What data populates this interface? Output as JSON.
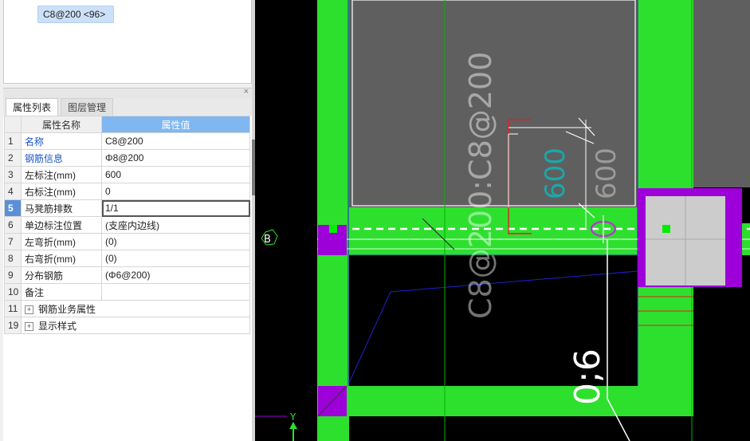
{
  "tree": {
    "selected_item": "C8@200 <96>"
  },
  "property_panel": {
    "tabs": [
      "属性列表",
      "图层管理"
    ],
    "headers": {
      "name": "属性名称",
      "value": "属性值"
    },
    "rows": [
      {
        "index": "1",
        "name": "名称",
        "value": "C8@200"
      },
      {
        "index": "2",
        "name": "钢筋信息",
        "value": "Φ8@200"
      },
      {
        "index": "3",
        "name": "左标注(mm)",
        "value": "600"
      },
      {
        "index": "4",
        "name": "右标注(mm)",
        "value": "0"
      },
      {
        "index": "5",
        "name": "马凳筋排数",
        "value": "1/1"
      },
      {
        "index": "6",
        "name": "单边标注位置",
        "value": "(支座内边线)"
      },
      {
        "index": "7",
        "name": "左弯折(mm)",
        "value": "(0)"
      },
      {
        "index": "8",
        "name": "右弯折(mm)",
        "value": "(0)"
      },
      {
        "index": "9",
        "name": "分布钢筋",
        "value": "(Φ6@200)"
      },
      {
        "index": "10",
        "name": "备注",
        "value": ""
      },
      {
        "index": "11",
        "name": "钢筋业务属性",
        "value": ""
      },
      {
        "index": "19",
        "name": "显示样式",
        "value": ""
      }
    ],
    "expander_symbol": "+",
    "close_symbol": "×"
  },
  "canvas": {
    "vertical_text_main": "C8@200:C8@200",
    "dimension_text_1": "600",
    "dimension_text_2": "600",
    "bottom_text": "0;6",
    "axis_label": "B",
    "y_axis_label": "Y",
    "colors": {
      "background": "#000000",
      "wall": "#2ee02e",
      "slab": "#5f5f5f",
      "column": "#9d00d8",
      "column_fill": "#cccccc",
      "dimension_red": "#e02020",
      "cyan_text": "#1aa8a8",
      "grey_text": "#9a9a9a",
      "magenta_text": "#b03cc8",
      "grid_line": "#00b400",
      "blue_line": "#2020d0"
    }
  }
}
